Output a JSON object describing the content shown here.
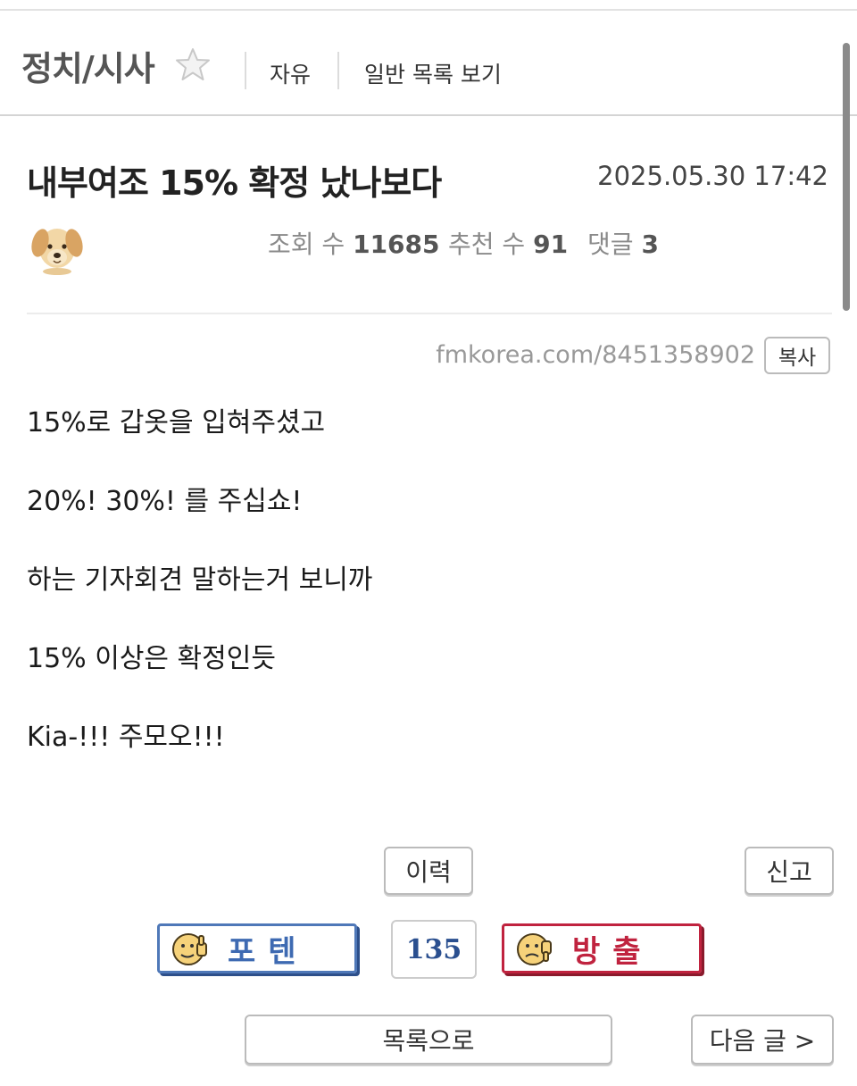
{
  "header": {
    "board_title": "정치/시사",
    "links": [
      "자유",
      "일반 목록 보기"
    ]
  },
  "post": {
    "title": "내부여조 15% 확정 났나보다",
    "date": "2025.05.30 17:42",
    "stats": {
      "views_label": "조회 수",
      "views": "11685",
      "recommend_label": "추천 수",
      "recommend": "91",
      "comments_label": "댓글",
      "comments": "3"
    },
    "url": "fmkorea.com/8451358902",
    "copy_label": "복사",
    "body_lines": [
      "15%로 갑옷을 입혀주셨고",
      "20%! 30%! 를 주십쇼!",
      "하는 기자회견 말하는거 보니까",
      "15% 이상은 확정인듯",
      "Kia-!!! 주모오!!!"
    ]
  },
  "actions": {
    "history_label": "이력",
    "report_label": "신고",
    "upvote_label": "포텐",
    "vote_count": "135",
    "downvote_label": "방출",
    "list_label": "목록으로",
    "next_label": "다음 글 >"
  },
  "colors": {
    "upvote": "#3e6ab2",
    "downvote": "#c0233f",
    "count": "#2a4f8f"
  },
  "icons": {
    "favorite": "star-icon",
    "avatar": "puppy-avatar",
    "upvote": "thumbs-up-face-icon",
    "downvote": "thumbs-down-face-icon"
  }
}
